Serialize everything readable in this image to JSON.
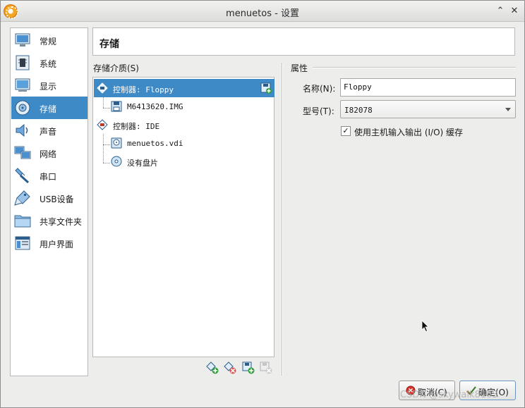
{
  "window": {
    "title": "menuetos - 设置",
    "minimize_glyph": "⌃",
    "close_glyph": "✕"
  },
  "nav": {
    "items": [
      {
        "label": "常规",
        "icon": "general-icon",
        "active": false
      },
      {
        "label": "系统",
        "icon": "system-icon",
        "active": false
      },
      {
        "label": "显示",
        "icon": "display-icon",
        "active": false
      },
      {
        "label": "存储",
        "icon": "storage-icon",
        "active": true
      },
      {
        "label": "声音",
        "icon": "audio-icon",
        "active": false
      },
      {
        "label": "网络",
        "icon": "network-icon",
        "active": false
      },
      {
        "label": "串口",
        "icon": "serial-port-icon",
        "active": false
      },
      {
        "label": "USB设备",
        "icon": "usb-icon",
        "active": false
      },
      {
        "label": "共享文件夹",
        "icon": "shared-folder-icon",
        "active": false
      },
      {
        "label": "用户界面",
        "icon": "user-interface-icon",
        "active": false
      }
    ]
  },
  "section": {
    "title": "存储"
  },
  "storage": {
    "label": "存储介质(S)",
    "tree": [
      {
        "label": "控制器: Floppy",
        "type": "controller-floppy",
        "selected": true
      },
      {
        "label": "M6413620.IMG",
        "type": "floppy-disk",
        "selected": false
      },
      {
        "label": "控制器: IDE",
        "type": "controller-ide",
        "selected": false
      },
      {
        "label": "menuetos.vdi",
        "type": "hard-disk",
        "selected": false
      },
      {
        "label": "没有盘片",
        "type": "optical-disc",
        "selected": false
      }
    ],
    "tools": [
      "add-controller-icon",
      "remove-controller-icon",
      "add-attachment-icon",
      "remove-attachment-icon"
    ]
  },
  "attributes": {
    "header": "属性",
    "name_label": "名称(N):",
    "name_value": "Floppy",
    "type_label": "型号(T):",
    "type_value": "I82078",
    "io_cache_label": "使用主机输入输出 (I/O) 缓存",
    "io_cache_checked": true,
    "check_glyph": "✓"
  },
  "buttons": {
    "cancel": "取消(C)",
    "ok": "确定(O)"
  },
  "watermark": "CSDN @skywalk8163",
  "colors": {
    "selection": "#3d8ac7",
    "window_bg": "#ededec"
  }
}
